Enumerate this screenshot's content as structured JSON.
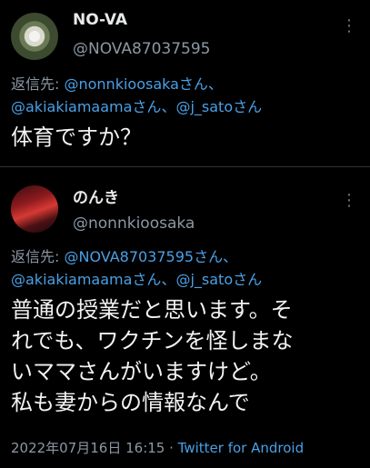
{
  "tweets": [
    {
      "author_name": "NO-VA",
      "handle": "@NOVA87037595",
      "reply_prefix": "返信先: ",
      "mentions": [
        "@nonnkioosaka",
        "@akiakiamaama",
        "@j_sato"
      ],
      "mention_suffix": "さん",
      "separator": "、",
      "text": "体育ですか？",
      "more_icon": "⋮"
    },
    {
      "author_name": "のんき",
      "handle": "@nonnkioosaka",
      "reply_prefix": "返信先: ",
      "mentions": [
        "@NOVA87037595",
        "@akiakiamaama",
        "@j_sato"
      ],
      "mention_suffix": "さん",
      "separator": "、",
      "text": "普通の授業だと思います。そ\nれでも、ワクチンを怪しまな\nいママさんがいますけど。\n私も妻からの情報なんで",
      "timestamp": "2022年07月16日 16:15",
      "dot": " · ",
      "source": "Twitter for Android",
      "more_icon": "⋮"
    }
  ],
  "colors": {
    "background": "#000000",
    "link": "#4aa0e6",
    "muted": "#8b98a5"
  }
}
